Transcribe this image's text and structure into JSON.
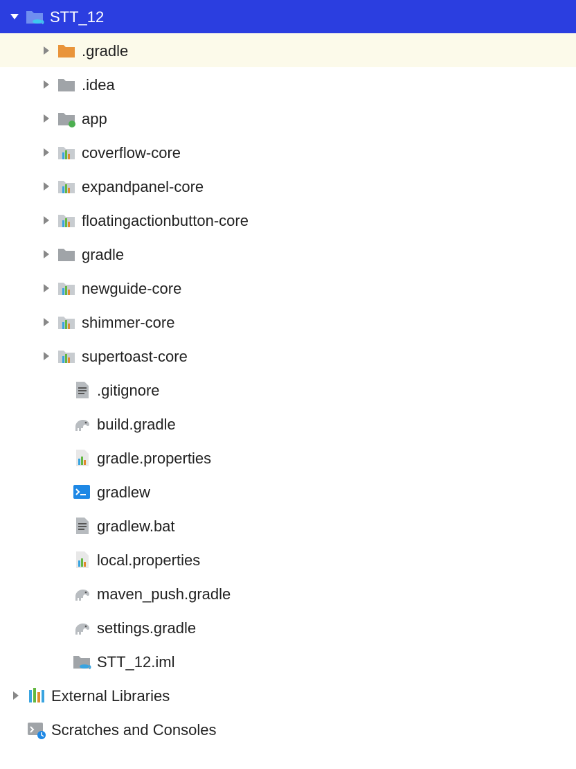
{
  "root": {
    "label": "STT_12"
  },
  "children": [
    {
      "label": ".gradle",
      "icon": "folder-orange",
      "expandable": true,
      "selected": true
    },
    {
      "label": ".idea",
      "icon": "folder",
      "expandable": true
    },
    {
      "label": "app",
      "icon": "folder-dot",
      "expandable": true
    },
    {
      "label": "coverflow-core",
      "icon": "module",
      "expandable": true
    },
    {
      "label": "expandpanel-core",
      "icon": "module",
      "expandable": true
    },
    {
      "label": "floatingactionbutton-core",
      "icon": "module",
      "expandable": true
    },
    {
      "label": "gradle",
      "icon": "folder",
      "expandable": true
    },
    {
      "label": "newguide-core",
      "icon": "module",
      "expandable": true
    },
    {
      "label": "shimmer-core",
      "icon": "module",
      "expandable": true
    },
    {
      "label": "supertoast-core",
      "icon": "module",
      "expandable": true
    },
    {
      "label": ".gitignore",
      "icon": "textfile",
      "expandable": false
    },
    {
      "label": "build.gradle",
      "icon": "elephant",
      "expandable": false
    },
    {
      "label": "gradle.properties",
      "icon": "props",
      "expandable": false
    },
    {
      "label": "gradlew",
      "icon": "terminal",
      "expandable": false
    },
    {
      "label": "gradlew.bat",
      "icon": "textfile",
      "expandable": false
    },
    {
      "label": "local.properties",
      "icon": "props",
      "expandable": false
    },
    {
      "label": "maven_push.gradle",
      "icon": "elephant",
      "expandable": false
    },
    {
      "label": "settings.gradle",
      "icon": "elephant",
      "expandable": false
    },
    {
      "label": "STT_12.iml",
      "icon": "iml",
      "expandable": false
    }
  ],
  "extraRoots": [
    {
      "label": "External Libraries",
      "icon": "libs",
      "expandable": true
    },
    {
      "label": "Scratches and Consoles",
      "icon": "scratch",
      "expandable": false
    }
  ]
}
